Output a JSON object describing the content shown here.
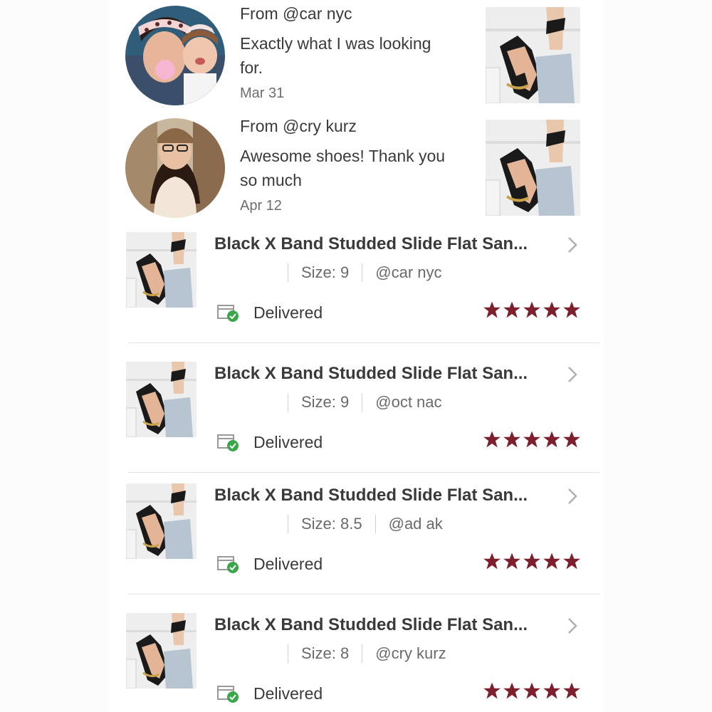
{
  "reviews": [
    {
      "from": "From @car      nyc",
      "text": "Exactly what I was looking for.",
      "date": "Mar 31",
      "avatar_icon": "reviewer-avatar-photo"
    },
    {
      "from": "From @cry      kurz",
      "text": "Awesome shoes! Thank you so much",
      "date": "Apr 12",
      "avatar_icon": "reviewer-avatar-photo"
    }
  ],
  "orders": [
    {
      "title": "Black X Band Studded Slide Flat San...",
      "size": "Size: 9",
      "buyer": "@car      nyc",
      "status": "Delivered",
      "rating": 5
    },
    {
      "title": "Black X Band Studded Slide Flat San...",
      "size": "Size: 9",
      "buyer": "@oct      nac",
      "status": "Delivered",
      "rating": 5
    },
    {
      "title": "Black X Band Studded Slide Flat San...",
      "size": "Size: 8.5",
      "buyer": "@ad      ak",
      "status": "Delivered",
      "rating": 5
    },
    {
      "title": "Black X Band Studded Slide Flat San...",
      "size": "Size: 8",
      "buyer": "@cry      kurz",
      "status": "Delivered",
      "rating": 5
    }
  ],
  "colors": {
    "star": "#7d1f2d",
    "delivered_check": "#3aa64a",
    "text": "#3a3a3a",
    "muted": "#6a6a6a",
    "divider": "#e2e2e2"
  }
}
